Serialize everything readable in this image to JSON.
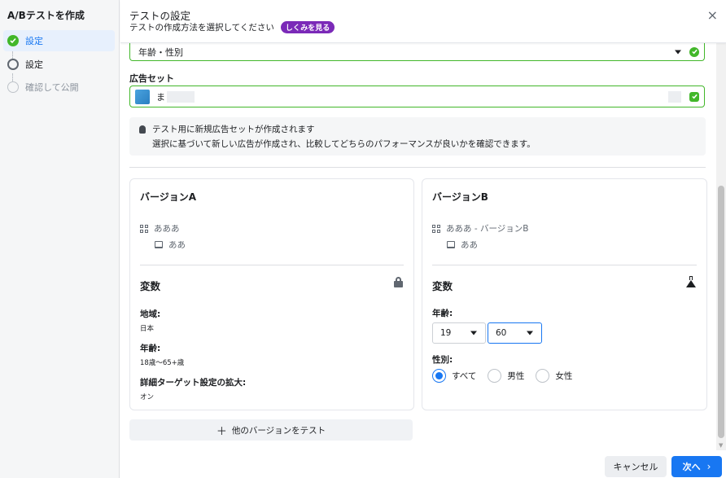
{
  "sidebar": {
    "title": "A/Bテストを作成",
    "steps": [
      {
        "label": "設定",
        "state": "done"
      },
      {
        "label": "設定",
        "state": "todo"
      },
      {
        "label": "確認して公開",
        "state": "disabled"
      }
    ]
  },
  "header": {
    "title": "テストの設定",
    "subtitle": "テストの作成方法を選択してください",
    "badge": "しくみを見る",
    "close": "×"
  },
  "variable_select": {
    "value": "年齢・性別"
  },
  "adset": {
    "label": "広告セット",
    "value": "ま"
  },
  "info": {
    "line1": "テスト用に新規広告セットが作成されます",
    "line2": "選択に基づいて新しい広告が作成され、比較してどちらのパフォーマンスが良いかを確認できます。"
  },
  "version_a": {
    "title": "バージョンA",
    "campaign": "あああ",
    "ad": "ああ",
    "variables_title": "変数",
    "region_label": "地域:",
    "region_value": "日本",
    "age_label": "年齢:",
    "age_value": "18歳〜65+歳",
    "detail_label": "詳細ターゲット設定の拡大:",
    "detail_value": "オン"
  },
  "version_b": {
    "title": "バージョンB",
    "campaign": "あああ - バージョンB",
    "ad": "ああ",
    "variables_title": "変数",
    "age_label": "年齢:",
    "age_min": "19",
    "age_max": "60",
    "gender_label": "性別:",
    "gender_options": [
      {
        "label": "すべて",
        "checked": true
      },
      {
        "label": "男性",
        "checked": false
      },
      {
        "label": "女性",
        "checked": false
      }
    ]
  },
  "add_version": {
    "plus": "＋",
    "label": "他のバージョンをテスト"
  },
  "footer": {
    "cancel": "キャンセル",
    "next": "次へ",
    "next_chevron": "›"
  },
  "colors": {
    "primary": "#1877f2",
    "success": "#42b72a",
    "badge": "#7b2ab8"
  }
}
